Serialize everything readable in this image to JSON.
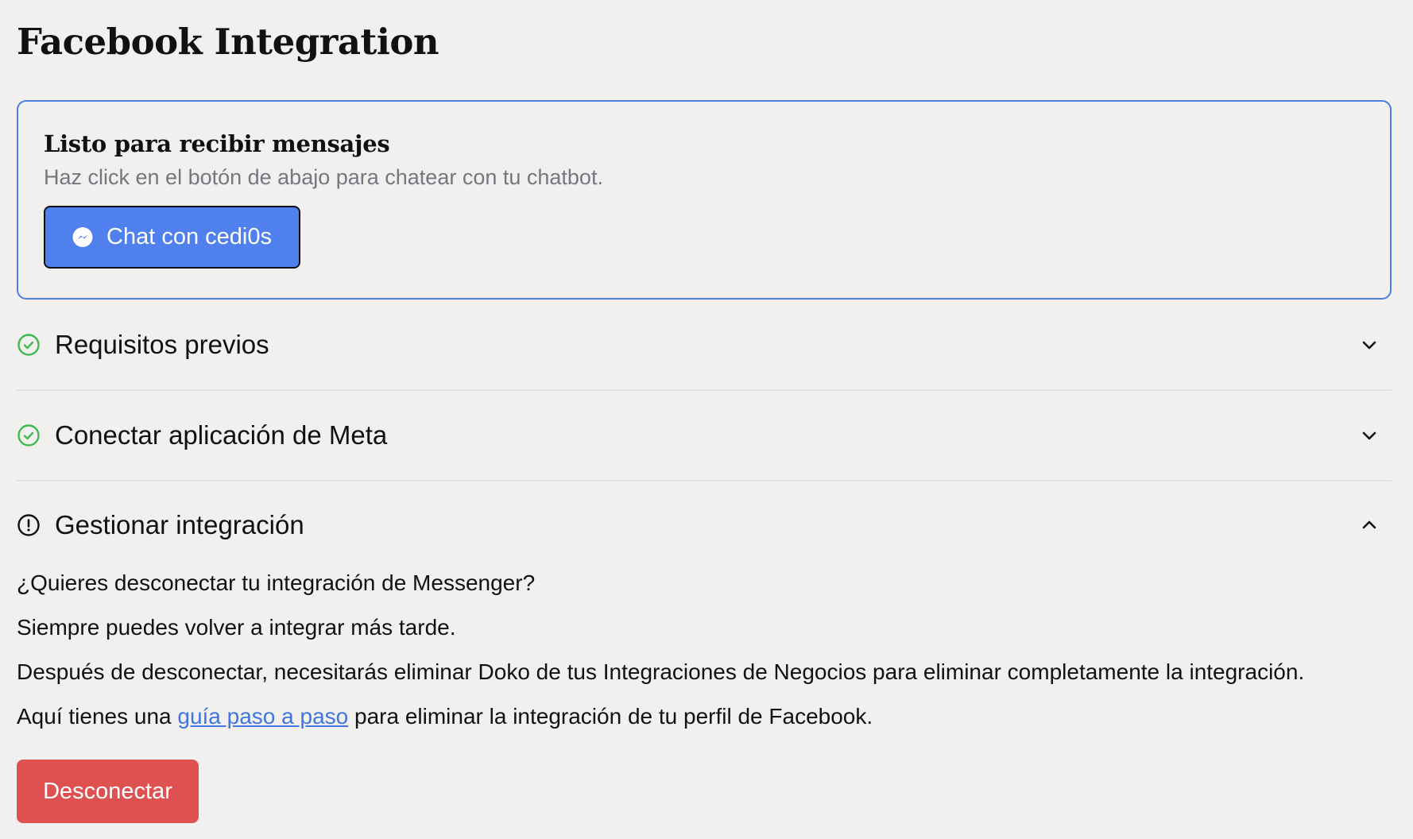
{
  "page": {
    "title": "Facebook Integration"
  },
  "status_card": {
    "title": "Listo para recibir mensajes",
    "subtitle": "Haz click en el botón de abajo para chatear con tu chatbot.",
    "chat_button_label": "Chat con cedi0s",
    "chat_button_icon": "messenger-icon"
  },
  "accordion": {
    "items": [
      {
        "title": "Requisitos previos",
        "status": "complete",
        "status_icon": "check-circle-icon",
        "toggle_icon": "chevron-down-icon",
        "expanded": false
      },
      {
        "title": "Conectar aplicación de Meta",
        "status": "complete",
        "status_icon": "check-circle-icon",
        "toggle_icon": "chevron-down-icon",
        "expanded": false
      },
      {
        "title": "Gestionar integración",
        "status": "warning",
        "status_icon": "alert-circle-icon",
        "toggle_icon": "chevron-up-icon",
        "expanded": true
      }
    ]
  },
  "manage": {
    "question": "¿Quieres desconectar tu integración de Messenger?",
    "reassure": "Siempre puedes volver a integrar más tarde.",
    "instruction": "Después de desconectar, necesitarás eliminar Doko de tus Integraciones de Negocios para eliminar completamente la integración.",
    "guide_prefix": "Aquí tienes una ",
    "guide_link": "guía paso a paso",
    "guide_suffix": " para eliminar la integración de tu perfil de Facebook.",
    "disconnect_label": "Desconectar"
  },
  "colors": {
    "background": "#f1f0ee",
    "card_border": "#4a7fe0",
    "primary_button": "#5080ee",
    "success": "#3fb950",
    "danger_button": "#df5151",
    "link": "#3f76e4",
    "muted_text": "#737780"
  }
}
